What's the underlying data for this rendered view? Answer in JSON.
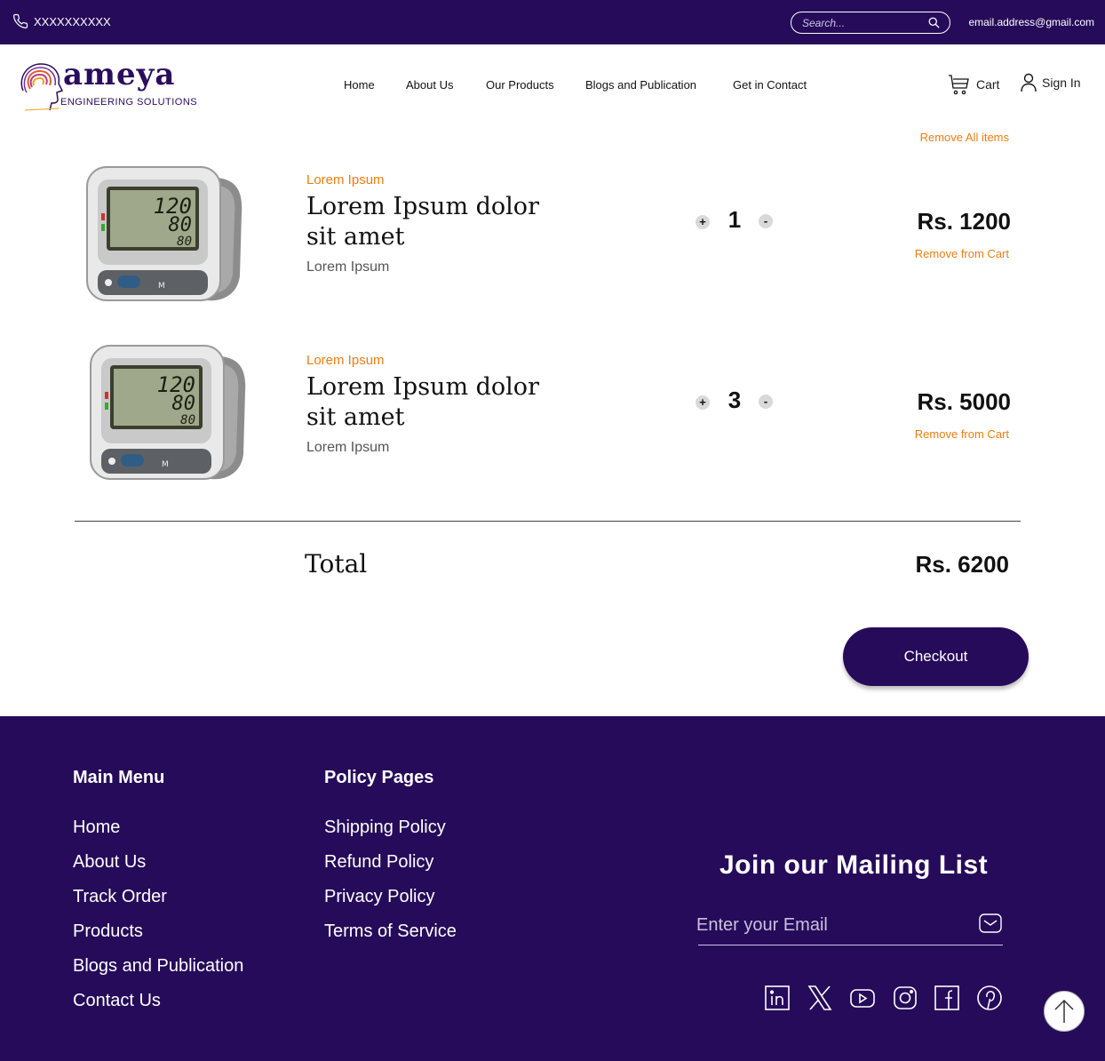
{
  "topbar": {
    "phone": "XXXXXXXXXX",
    "search_placeholder": "Search...",
    "email": "email.address@gmail.com"
  },
  "brand": {
    "name": "ameya",
    "tagline": "ENGINEERING SOLUTIONS"
  },
  "nav": [
    "Home",
    "About Us",
    "Our Products",
    "Blogs and Publication",
    "Get in Contact"
  ],
  "header_actions": {
    "cart": "Cart",
    "sign_in": "Sign In"
  },
  "cart": {
    "remove_all": "Remove All items",
    "items": [
      {
        "category": "Lorem Ipsum",
        "name": "Lorem Ipsum dolor sit amet",
        "subtitle": "Lorem Ipsum",
        "quantity": "1",
        "price": "Rs. 1200",
        "remove": "Remove from Cart"
      },
      {
        "category": "Lorem Ipsum",
        "name": "Lorem Ipsum dolor sit amet",
        "subtitle": "Lorem Ipsum",
        "quantity": "3",
        "price": "Rs. 5000",
        "remove": "Remove from Cart"
      }
    ],
    "total_label": "Total",
    "total_value": "Rs. 6200",
    "checkout": "Checkout",
    "increment_symbol": "+",
    "decrement_symbol": "-"
  },
  "device_display": {
    "sys": "120",
    "dia": "80",
    "pulse": "80",
    "button": "M"
  },
  "footer": {
    "main_menu_title": "Main Menu",
    "main_menu": [
      "Home",
      "About Us",
      "Track Order",
      "Products",
      "Blogs and Publication",
      "Contact Us"
    ],
    "policy_title": "Policy Pages",
    "policy": [
      "Shipping Policy",
      "Refund Policy",
      "Privacy Policy",
      "Terms of Service"
    ],
    "mailing_title": "Join our Mailing List",
    "email_placeholder": "Enter your Email",
    "social_icons": [
      "linkedin-icon",
      "x-icon",
      "youtube-icon",
      "instagram-icon",
      "facebook-icon",
      "pinterest-icon"
    ]
  },
  "colors": {
    "primary": "#260b5a",
    "accent": "#ee7d0f"
  }
}
